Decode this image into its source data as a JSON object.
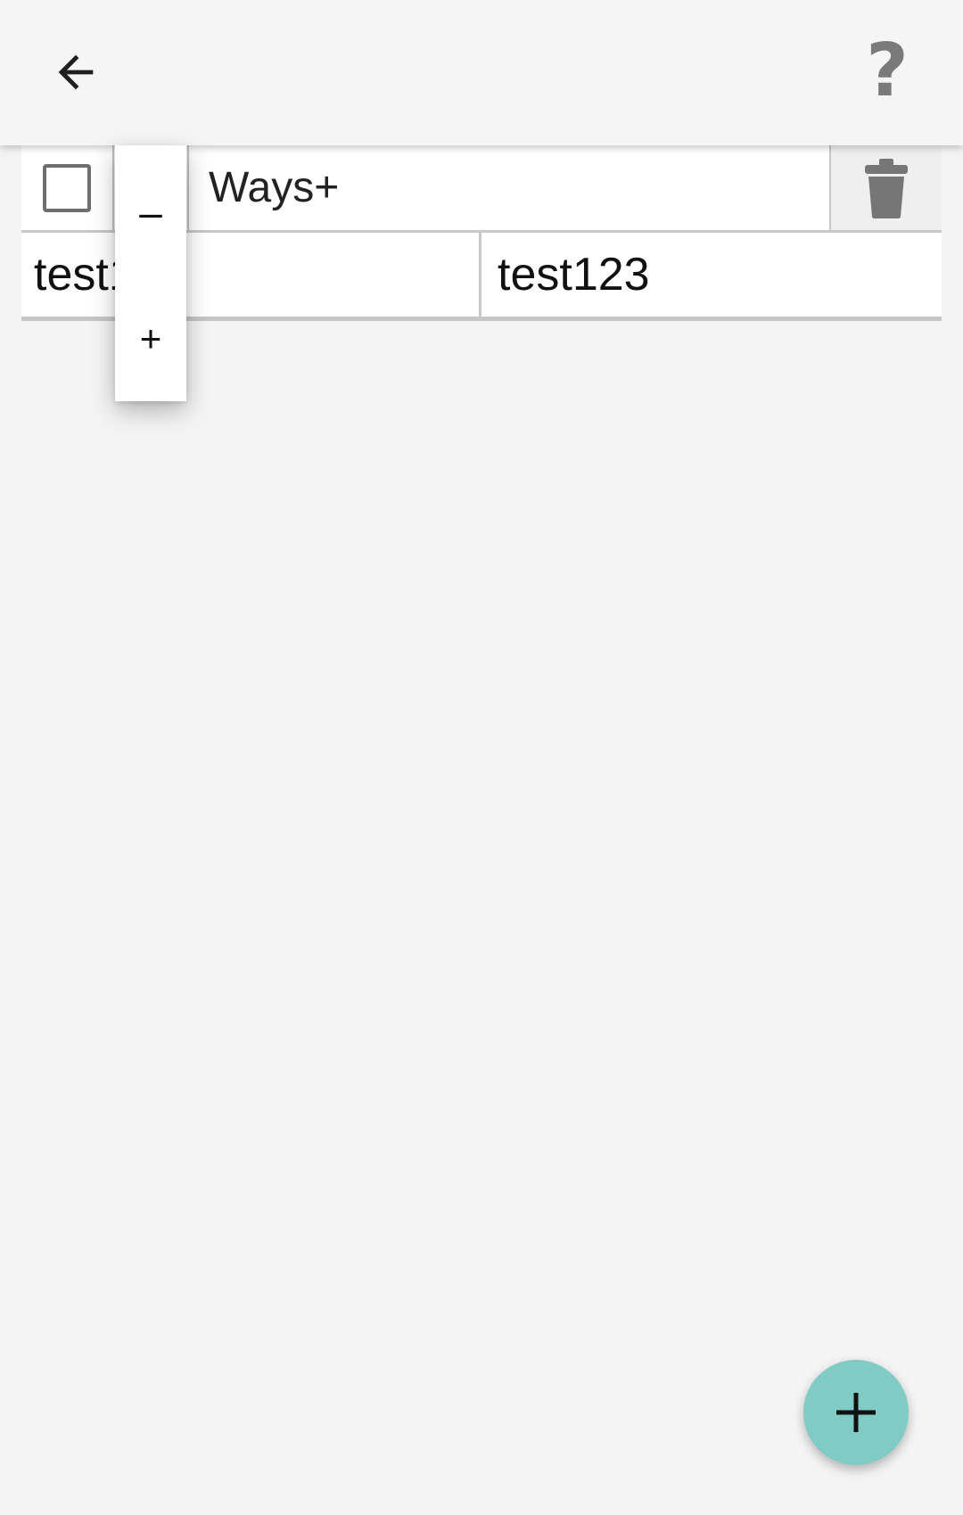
{
  "app_bar": {
    "back_icon": "arrow-left-icon",
    "help_label": "?",
    "help_icon_color": "#7a7a7a"
  },
  "header_row": {
    "key_value": "Ways+",
    "checkbox_checked": false,
    "delete_icon": "trash-icon"
  },
  "tag_rows": [
    {
      "key": "test123",
      "value": "test123"
    }
  ],
  "zoom_popup": {
    "minus_label": "–",
    "plus_label": "+"
  },
  "fab": {
    "icon": "plus-icon",
    "color": "#80cbc4"
  }
}
